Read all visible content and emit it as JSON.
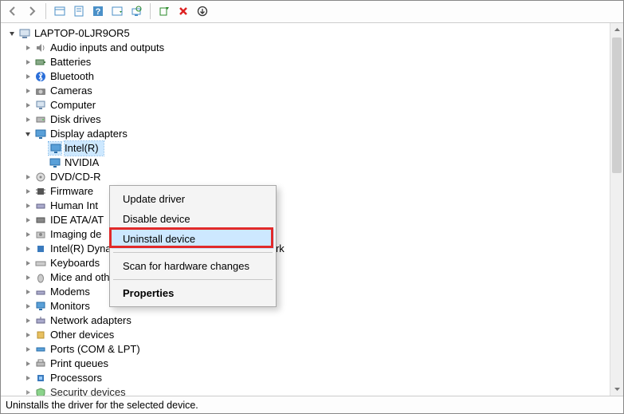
{
  "toolbar": {
    "buttons": [
      {
        "name": "nav-back-icon",
        "hint": "Back"
      },
      {
        "name": "nav-forward-icon",
        "hint": "Forward"
      },
      {
        "sep": true
      },
      {
        "name": "show-hidden-icon",
        "hint": "Show hidden"
      },
      {
        "name": "properties-icon",
        "hint": "Properties"
      },
      {
        "name": "help-icon",
        "hint": "Help"
      },
      {
        "name": "action-icon",
        "hint": "Action"
      },
      {
        "name": "scan-hardware-icon",
        "hint": "Scan for hardware changes"
      },
      {
        "sep": true
      },
      {
        "name": "add-driver-icon",
        "hint": "Add driver"
      },
      {
        "name": "remove-icon",
        "hint": "Remove"
      },
      {
        "name": "more-icon",
        "hint": "More"
      }
    ]
  },
  "tree": {
    "root": {
      "label": "LAPTOP-0LJR9OR5",
      "expanded": true,
      "icon": "computer-icon"
    },
    "categories": [
      {
        "label": "Audio inputs and outputs",
        "icon": "audio-icon",
        "expanded": false
      },
      {
        "label": "Batteries",
        "icon": "battery-icon",
        "expanded": false
      },
      {
        "label": "Bluetooth",
        "icon": "bluetooth-icon",
        "expanded": false
      },
      {
        "label": "Cameras",
        "icon": "camera-icon",
        "expanded": false
      },
      {
        "label": "Computer",
        "icon": "pc-icon",
        "expanded": false
      },
      {
        "label": "Disk drives",
        "icon": "disk-icon",
        "expanded": false
      },
      {
        "label": "Display adapters",
        "icon": "display-icon",
        "expanded": true,
        "children": [
          {
            "label": "Intel(R)",
            "icon": "display-icon",
            "selected": true,
            "truncated": true
          },
          {
            "label": "NVIDIA",
            "icon": "display-icon",
            "truncated": true
          }
        ]
      },
      {
        "label": "DVD/CD-R",
        "icon": "dvd-icon",
        "expanded": false,
        "truncated": true
      },
      {
        "label": "Firmware",
        "icon": "firmware-icon",
        "expanded": false
      },
      {
        "label": "Human Int",
        "icon": "hid-icon",
        "expanded": false,
        "truncated": true
      },
      {
        "label": "IDE ATA/AT",
        "icon": "ide-icon",
        "expanded": false,
        "truncated": true
      },
      {
        "label": "Imaging de",
        "icon": "imaging-icon",
        "expanded": false,
        "truncated": true
      },
      {
        "label": "Intel(R) Dynamic Platform and Thermal Framework",
        "icon": "chip-icon",
        "expanded": false
      },
      {
        "label": "Keyboards",
        "icon": "keyboard-icon",
        "expanded": false
      },
      {
        "label": "Mice and other pointing devices",
        "icon": "mouse-icon",
        "expanded": false
      },
      {
        "label": "Modems",
        "icon": "modem-icon",
        "expanded": false
      },
      {
        "label": "Monitors",
        "icon": "monitor-icon",
        "expanded": false
      },
      {
        "label": "Network adapters",
        "icon": "network-icon",
        "expanded": false
      },
      {
        "label": "Other devices",
        "icon": "other-icon",
        "expanded": false
      },
      {
        "label": "Ports (COM & LPT)",
        "icon": "port-icon",
        "expanded": false
      },
      {
        "label": "Print queues",
        "icon": "printer-icon",
        "expanded": false
      },
      {
        "label": "Processors",
        "icon": "cpu-icon",
        "expanded": false
      },
      {
        "label": "Security devices",
        "icon": "security-icon",
        "expanded": false,
        "faded": true
      }
    ]
  },
  "context_menu": {
    "items": [
      {
        "label": "Update driver",
        "name": "menu-update-driver"
      },
      {
        "label": "Disable device",
        "name": "menu-disable-device"
      },
      {
        "label": "Uninstall device",
        "name": "menu-uninstall-device",
        "hovered": true,
        "highlighted": true
      },
      {
        "sep": true
      },
      {
        "label": "Scan for hardware changes",
        "name": "menu-scan-hardware"
      },
      {
        "sep": true
      },
      {
        "label": "Properties",
        "name": "menu-properties",
        "bold": true
      }
    ]
  },
  "statusbar": {
    "text": "Uninstalls the driver for the selected device."
  },
  "colors": {
    "selection": "#cde8ff",
    "highlight_border": "#e12a2a"
  }
}
